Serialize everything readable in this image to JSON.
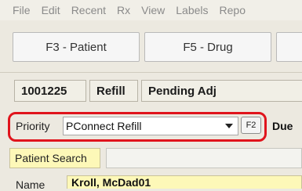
{
  "menu": [
    "File",
    "Edit",
    "Recent",
    "Rx",
    "View",
    "Labels",
    "Repo"
  ],
  "fkeys": {
    "patient_label": "F3 - Patient",
    "drug_label": "F5 - Drug"
  },
  "refill_row": {
    "rx_number": "1001225",
    "type": "Refill",
    "status": "Pending Adj"
  },
  "priority": {
    "label": "Priority",
    "selected": "PConnect Refill",
    "f2_label": "F2"
  },
  "due_label": "Due",
  "patient_search": {
    "label": "Patient Search",
    "value": ""
  },
  "name": {
    "label": "Name",
    "value": "Kroll, McDad01"
  },
  "colors": {
    "highlight_outline": "#e0141c",
    "field_highlight": "#fdf8b8"
  }
}
